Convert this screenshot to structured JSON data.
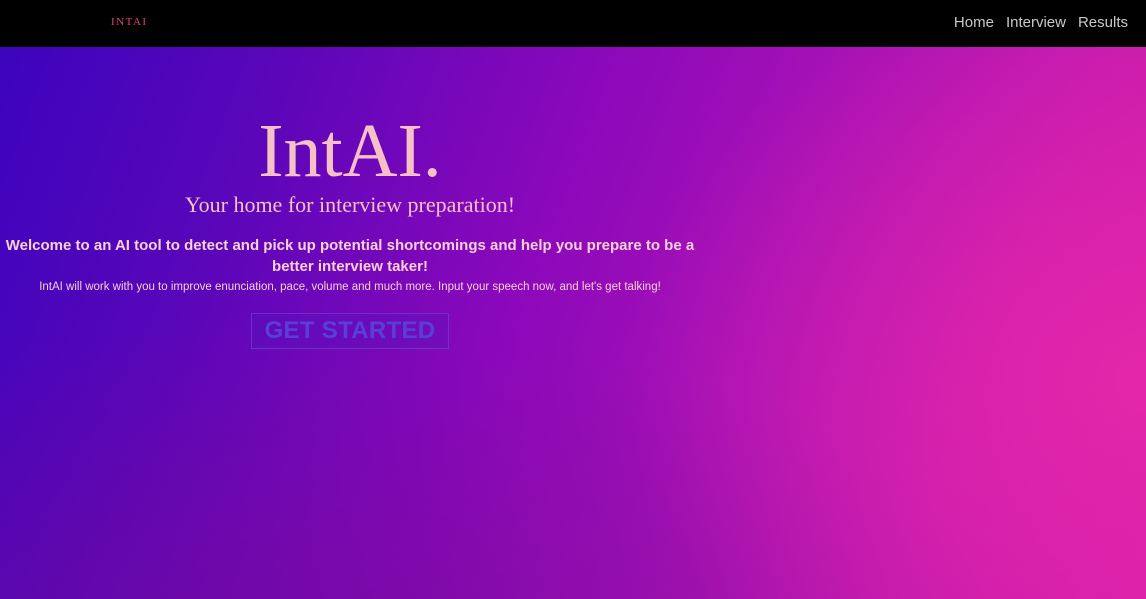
{
  "navbar": {
    "brand": "INTAI",
    "links": [
      {
        "label": "Home"
      },
      {
        "label": "Interview"
      },
      {
        "label": "Results"
      }
    ]
  },
  "hero": {
    "title": "IntAI.",
    "subtitle": "Your home for interview preparation!",
    "welcome": "Welcome to an AI tool to detect and pick up potential shortcomings and help you prepare to be a better interview taker!",
    "description": "IntAI will work with you to improve enunciation, pace, volume and much more. Input your speech now, and let's get talking!",
    "cta_label": "GET STARTED"
  },
  "colors": {
    "navbar_bg": "#000000",
    "brand": "#e0407e",
    "nav_link": "#c9c9c9",
    "hero_text": "#f5c0c6",
    "cta_text": "#5a3fd6",
    "gradient_start": "#3a04bd",
    "gradient_end": "#d41fa8"
  }
}
